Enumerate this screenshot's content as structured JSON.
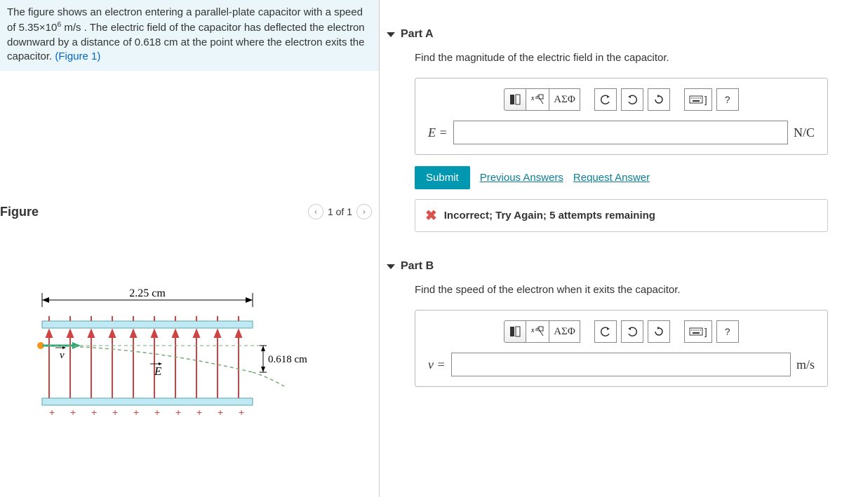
{
  "problem": {
    "text_before": "The figure shows an electron entering a parallel-plate capacitor with a speed of 5.35×10",
    "exp": "6",
    "text_mid": " m/s . The electric field of the capacitor has deflected the electron downward by a distance of 0.618 cm at the point where the electron exits the capacitor. ",
    "fig_link": "(Figure 1)"
  },
  "figure": {
    "heading": "Figure",
    "counter": "1 of 1",
    "width_label": "2.25 cm",
    "deflection_label": "0.618 cm",
    "v_label": "v",
    "e_label": "E"
  },
  "partA": {
    "title": "Part A",
    "prompt": "Find the magnitude of the electric field in the capacitor.",
    "toolbar": {
      "greek": "ΑΣΦ",
      "help": "?"
    },
    "eq_label": "E =",
    "units": "N/C",
    "submit": "Submit",
    "prev_answers": "Previous Answers",
    "req_answer": "Request Answer",
    "feedback": "Incorrect; Try Again; 5 attempts remaining"
  },
  "partB": {
    "title": "Part B",
    "prompt": "Find the speed of the electron when it exits the capacitor.",
    "toolbar": {
      "greek": "ΑΣΦ",
      "help": "?"
    },
    "eq_label": "v =",
    "units": "m/s"
  }
}
